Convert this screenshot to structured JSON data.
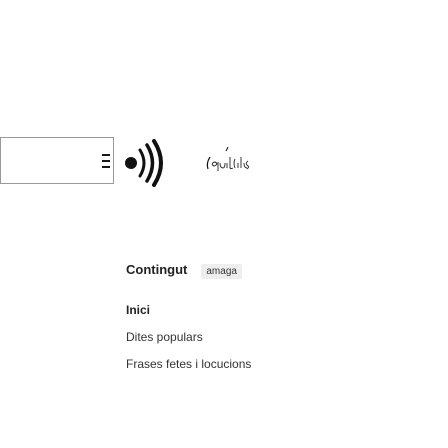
{
  "header": {
    "menu_icon": "hamburger-menu-icon",
    "logo_icon": "sound-waves-icon",
    "logo_text": "Paraules"
  },
  "sidebar": {
    "contents_label": "Contingut",
    "hide_label": "amaga",
    "items": [
      {
        "label": "Inici",
        "current": true
      },
      {
        "label": "Dites populars",
        "current": false
      },
      {
        "label": "Frases fetes i locucions",
        "current": false
      }
    ]
  }
}
